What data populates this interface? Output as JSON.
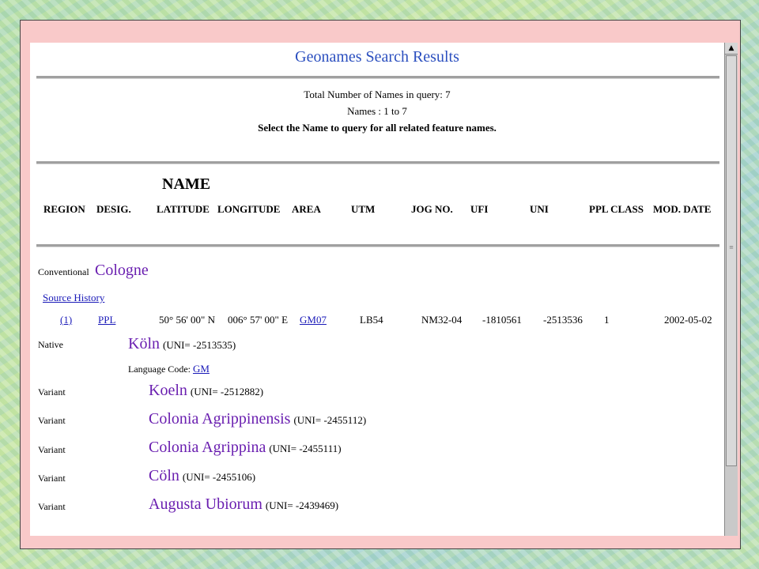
{
  "title": "Geonames Search Results",
  "summary": {
    "total": "Total Number of Names in query: 7",
    "range": "Names : 1 to 7",
    "instruction": "Select the Name to query for all related feature names."
  },
  "name_heading": "NAME",
  "columns": [
    "REGION",
    "DESIG.",
    "LATITUDE",
    "LONGITUDE",
    "AREA",
    "UTM",
    "JOG NO.",
    "UFI",
    "UNI",
    "PPL CLASS",
    "MOD. DATE"
  ],
  "conventional": {
    "label": "Conventional",
    "name": "Cologne"
  },
  "source_history": "Source History",
  "row": {
    "region": "(1)",
    "desig": "PPL",
    "latitude": "50° 56' 00\" N",
    "longitude": "006° 57' 00\" E",
    "area": "GM07",
    "utm": "LB54",
    "jog": "NM32-04",
    "ufi": "-1810561",
    "uni": "-2513536",
    "ppl_class": "1",
    "mod_date": "2002-05-02"
  },
  "native": {
    "label": "Native",
    "name": "Köln",
    "uni": "(UNI= -2513535)",
    "language_label": "Language Code:",
    "language_code": "GM"
  },
  "variants": [
    {
      "label": "Variant",
      "name": "Koeln",
      "uni": "(UNI= -2512882)"
    },
    {
      "label": "Variant",
      "name": "Colonia Agrippinensis",
      "uni": "(UNI= -2455112)"
    },
    {
      "label": "Variant",
      "name": "Colonia Agrippina",
      "uni": "(UNI= -2455111)"
    },
    {
      "label": "Variant",
      "name": "Cöln",
      "uni": "(UNI= -2455106)"
    },
    {
      "label": "Variant",
      "name": "Augusta Ubiorum",
      "uni": "(UNI= -2439469)"
    }
  ],
  "colors": {
    "title": "#2b4fbf",
    "link": "#1a1ab8",
    "name": "#6a1fb0",
    "frame": "#f9c9c9"
  },
  "icons": {
    "scroll_up": "triangle-up-icon",
    "grip": "scroll-grip-icon"
  }
}
